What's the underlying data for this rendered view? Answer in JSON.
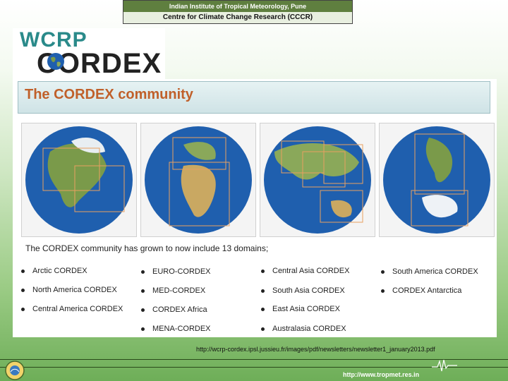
{
  "header": {
    "institute": "Indian Institute of Tropical Meteorology, Pune",
    "centre": "Centre for Climate Change Research (CCCR)"
  },
  "logo": {
    "line1": "WCRP",
    "line2": "CORDEX"
  },
  "slide": {
    "title": "The CORDEX community",
    "intro": "The CORDEX community has grown to now include 13 domains;",
    "domains": [
      [
        "Arctic CORDEX",
        "North America CORDEX",
        "Central America CORDEX"
      ],
      [
        "EURO-CORDEX",
        "MED-CORDEX",
        "CORDEX Africa",
        "MENA-CORDEX"
      ],
      [
        "Central Asia CORDEX",
        "South Asia CORDEX",
        "East Asia CORDEX",
        "Australasia CORDEX"
      ],
      [
        "South America CORDEX",
        "CORDEX Antarctica"
      ]
    ],
    "globes": [
      "globe-arctic-north-america-icon",
      "globe-europe-africa-icon",
      "globe-asia-australia-icon",
      "globe-south-america-antarctica-icon"
    ]
  },
  "source_url": "http://wcrp-cordex.ipsl.jussieu.fr/images/pdf/newsletters/newsletter1_january2013.pdf",
  "footer": {
    "url": "http://www.tropmet.res.in"
  },
  "colors": {
    "title": "#c0602a",
    "header_band": "#5f7f3f",
    "ocean": "#1f5fae",
    "land": "#7a9a4a"
  }
}
